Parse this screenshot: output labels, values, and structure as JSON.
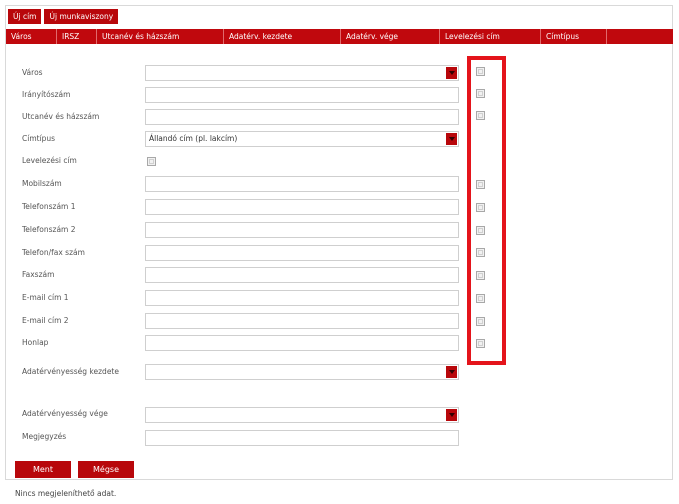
{
  "toolbar": {
    "new_address": "Új cím",
    "new_employment": "Új munkaviszony"
  },
  "columns": [
    "Város",
    "IRSZ",
    "Utcanév és házszám",
    "Adatérv. kezdete",
    "Adatérv. vége",
    "Levelezési cím",
    "Címtípus"
  ],
  "form": {
    "city_label": "Város",
    "zip_label": "Irányítószám",
    "street_label": "Utcanév és házszám",
    "addrtype_label": "Címtípus",
    "addrtype_value": "Állandó cím (pl. lakcím)",
    "mailing_label": "Levelezési cím",
    "mobile_label": "Mobilszám",
    "phone1_label": "Telefonszám 1",
    "phone2_label": "Telefonszám 2",
    "phonefax_label": "Telefon/fax szám",
    "fax_label": "Faxszám",
    "email1_label": "E-mail cím 1",
    "email2_label": "E-mail cím 2",
    "homepage_label": "Honlap",
    "validfrom_label": "Adatérvényesség kezdete",
    "validto_label": "Adatérvényesség vége",
    "note_label": "Megjegyzés"
  },
  "actions": {
    "save": "Ment",
    "cancel": "Mégse"
  },
  "status": {
    "empty_message": "Nincs megjeleníthető adat."
  },
  "colors": {
    "accent": "#c0080d",
    "highlight": "#e4141b"
  }
}
